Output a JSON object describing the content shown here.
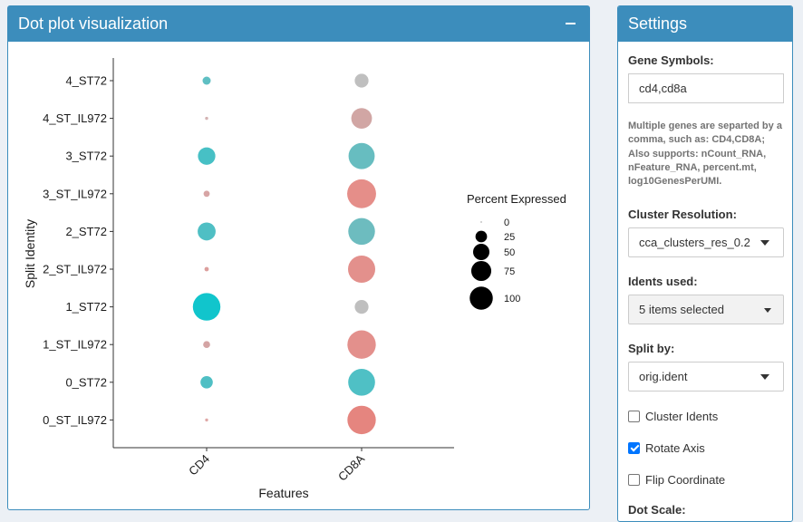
{
  "plot_panel": {
    "title": "Dot plot visualization",
    "collapse_icon": "minus-icon"
  },
  "settings": {
    "title": "Settings",
    "gene_symbols_label": "Gene Symbols:",
    "gene_symbols_value": "cd4,cd8a",
    "gene_help": "Multiple genes are separted by a comma, such as: CD4,CD8A; Also supports: nCount_RNA, nFeature_RNA, percent.mt, log10GenesPerUMI.",
    "cluster_resolution_label": "Cluster Resolution:",
    "cluster_resolution_value": "cca_clusters_res_0.2",
    "idents_label": "Idents used:",
    "idents_value": "5 items selected",
    "split_label": "Split by:",
    "split_value": "orig.ident",
    "checkboxes": [
      {
        "label": "Cluster Idents",
        "checked": false
      },
      {
        "label": "Rotate Axis",
        "checked": true
      },
      {
        "label": "Flip Coordinate",
        "checked": false
      }
    ],
    "dot_scale_label": "Dot Scale:"
  },
  "chart_data": {
    "type": "dot",
    "xlabel": "Features",
    "ylabel": "Split Identity",
    "features": [
      "CD4",
      "CD8A"
    ],
    "identities": [
      "4_ST72",
      "4_ST_IL972",
      "3_ST72",
      "3_ST_IL972",
      "2_ST72",
      "2_ST_IL972",
      "1_ST72",
      "1_ST_IL972",
      "0_ST72",
      "0_ST_IL972"
    ],
    "legend_title": "Percent Expressed",
    "legend_values": [
      "0",
      "25",
      "50",
      "75",
      "100"
    ],
    "legend_placement": "right",
    "points": [
      {
        "identity": "4_ST72",
        "feature": "CD4",
        "pct": 7,
        "color": "#5fbfc3"
      },
      {
        "identity": "4_ST72",
        "feature": "CD8A",
        "pct": 20,
        "color": "#bfbfbf"
      },
      {
        "identity": "4_ST_IL972",
        "feature": "CD4",
        "pct": 1,
        "color": "#d4b3b3"
      },
      {
        "identity": "4_ST_IL972",
        "feature": "CD8A",
        "pct": 45,
        "color": "#d1a6a4"
      },
      {
        "identity": "3_ST72",
        "feature": "CD4",
        "pct": 32,
        "color": "#47c0c5"
      },
      {
        "identity": "3_ST72",
        "feature": "CD8A",
        "pct": 72,
        "color": "#67bdc0"
      },
      {
        "identity": "3_ST_IL972",
        "feature": "CD4",
        "pct": 4,
        "color": "#d7a5a5"
      },
      {
        "identity": "3_ST_IL972",
        "feature": "CD8A",
        "pct": 88,
        "color": "#e58e89"
      },
      {
        "identity": "2_ST72",
        "feature": "CD4",
        "pct": 34,
        "color": "#4fbfc4"
      },
      {
        "identity": "2_ST72",
        "feature": "CD8A",
        "pct": 75,
        "color": "#6dbcbf"
      },
      {
        "identity": "2_ST_IL972",
        "feature": "CD4",
        "pct": 2,
        "color": "#dc9f9d"
      },
      {
        "identity": "2_ST_IL972",
        "feature": "CD8A",
        "pct": 78,
        "color": "#e3908c"
      },
      {
        "identity": "1_ST72",
        "feature": "CD4",
        "pct": 80,
        "color": "#11c5cc"
      },
      {
        "identity": "1_ST72",
        "feature": "CD8A",
        "pct": 20,
        "color": "#bfbfbf"
      },
      {
        "identity": "1_ST_IL972",
        "feature": "CD4",
        "pct": 5,
        "color": "#d4a4a4"
      },
      {
        "identity": "1_ST_IL972",
        "feature": "CD8A",
        "pct": 85,
        "color": "#e3908c"
      },
      {
        "identity": "0_ST72",
        "feature": "CD4",
        "pct": 16,
        "color": "#4fbfc4"
      },
      {
        "identity": "0_ST72",
        "feature": "CD8A",
        "pct": 76,
        "color": "#4fc0c5"
      },
      {
        "identity": "0_ST_IL972",
        "feature": "CD4",
        "pct": 1,
        "color": "#dfa8a6"
      },
      {
        "identity": "0_ST_IL972",
        "feature": "CD8A",
        "pct": 85,
        "color": "#e5857f"
      }
    ]
  }
}
